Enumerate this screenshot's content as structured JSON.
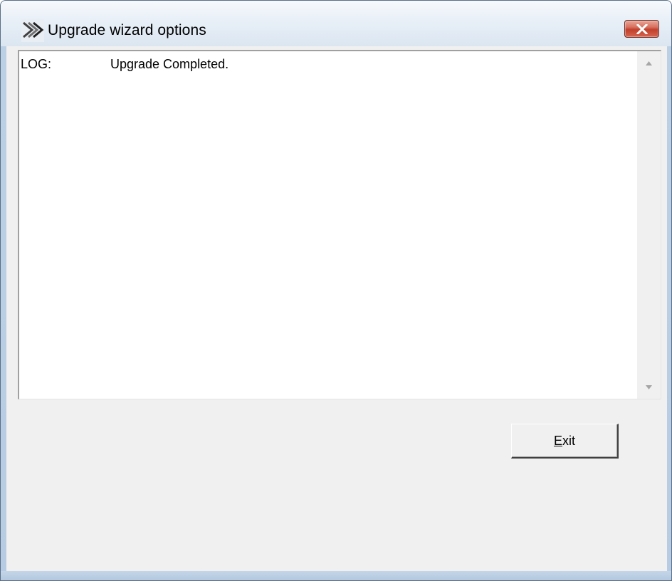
{
  "window": {
    "title": "Upgrade wizard options",
    "icon": "upgrade-wizard-arrow-icon",
    "close_icon": "close-icon"
  },
  "log": {
    "label": "LOG:",
    "message": "Upgrade Completed."
  },
  "scrollbar": {
    "up_icon": "scroll-up-arrow-icon",
    "down_icon": "scroll-down-arrow-icon"
  },
  "buttons": {
    "exit_mnemonic": "E",
    "exit_rest": "xit"
  },
  "colors": {
    "close_button": "#c2402c",
    "client_background": "#f0f0f0",
    "log_background": "#ffffff"
  }
}
